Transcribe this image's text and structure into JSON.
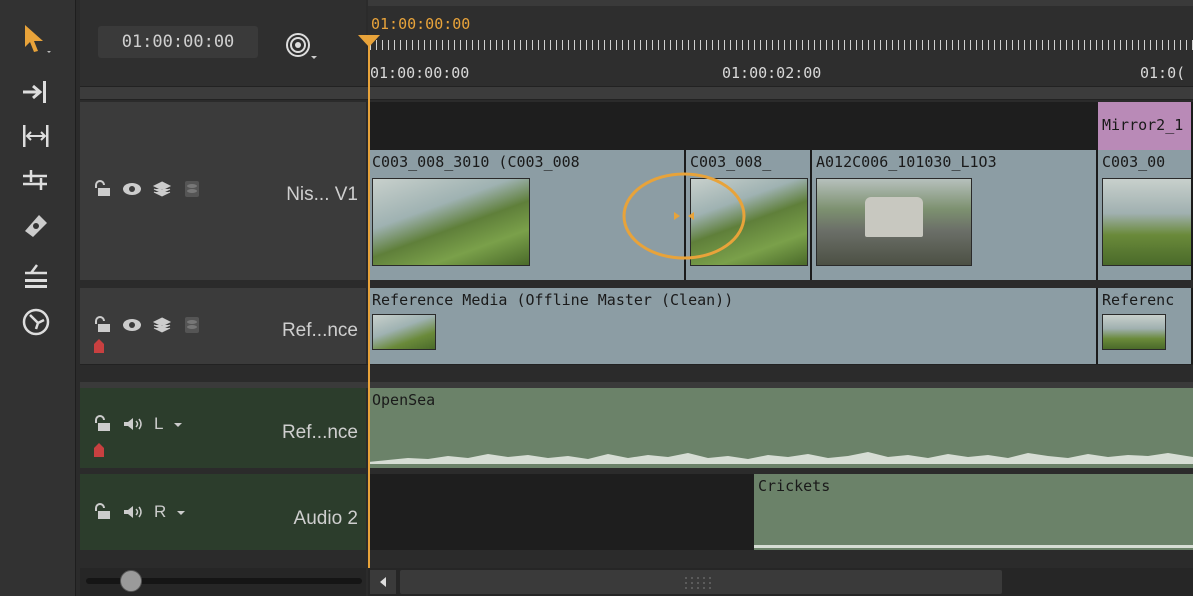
{
  "header": {
    "timecode": "01:00:00:00",
    "playhead_timecode": "01:00:00:00",
    "ruler_labels": [
      "01:00:00:00",
      "01:00:02:00",
      "01:0("
    ]
  },
  "tracks": {
    "video1": {
      "name": "Nis... V1"
    },
    "video2": {
      "name": "Ref...nce"
    },
    "audio1": {
      "name": "Ref...nce",
      "channel": "L"
    },
    "audio2": {
      "name": "Audio 2",
      "channel": "R"
    }
  },
  "clips": {
    "v1": [
      {
        "label": "C003_008_3010 (C003_008"
      },
      {
        "label": "C003_008_"
      },
      {
        "label": "A012C006_101030_L1O3"
      },
      {
        "label": "C003_00"
      }
    ],
    "v1_top": {
      "label": "Mirror2_1"
    },
    "v2": [
      {
        "label": "Reference Media (Offline Master (Clean))"
      },
      {
        "label": "Referenc"
      }
    ],
    "a1": {
      "label": "OpenSea"
    },
    "a2": {
      "label": "Crickets"
    }
  },
  "colors": {
    "video_clip": "#8c9da4",
    "audio_clip": "#6b8269",
    "audio_header": "#2c3d2c",
    "playhead": "#e8a33a",
    "effect_clip": "#b98ab7"
  }
}
